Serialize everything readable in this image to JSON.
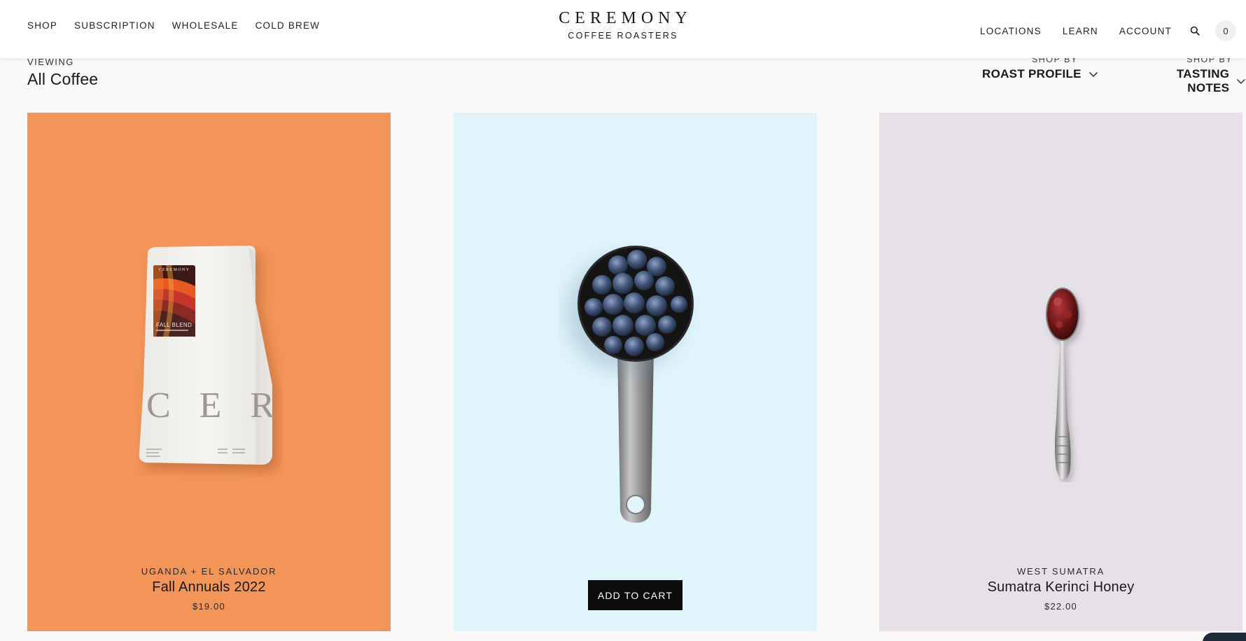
{
  "header": {
    "nav_left": [
      "SHOP",
      "SUBSCRIPTION",
      "WHOLESALE",
      "COLD BREW"
    ],
    "logo_main": "CEREMONY",
    "logo_sub": "COFFEE ROASTERS",
    "nav_right": [
      "LOCATIONS",
      "LEARN",
      "ACCOUNT"
    ],
    "search_icon": "search-icon",
    "cart_count": "0"
  },
  "subheader": {
    "viewing_label": "VIEWING",
    "viewing_value": "All Coffee",
    "filters": [
      {
        "label": "SHOP BY",
        "value": "ROAST PROFILE",
        "icon": "chevron-down-icon"
      },
      {
        "label": "SHOP BY",
        "value": "TASTING NOTES",
        "icon": "chevron-down-icon"
      }
    ]
  },
  "products": [
    {
      "origin": "UGANDA + EL SALVADOR",
      "name": "Fall Annuals 2022",
      "price": "$19.00",
      "background": "#f39459",
      "image": "coffee-bag",
      "bag_brand": "CEREMONY",
      "bag_label": "FALL BLEND",
      "bag_print": "C E R M"
    },
    {
      "background": "#e1f4fc",
      "image": "blueberry-scoop",
      "cta": "ADD TO CART"
    },
    {
      "origin": "WEST SUMATRA",
      "name": "Sumatra Kerinci Honey",
      "price": "$22.00",
      "background": "#e6e1e6",
      "image": "jam-spoon"
    }
  ],
  "colors": {
    "page_bg": "#faf9f7",
    "header_bg": "#ffffff",
    "button_bg": "#0d0d0d",
    "text": "#1d1d1d"
  }
}
